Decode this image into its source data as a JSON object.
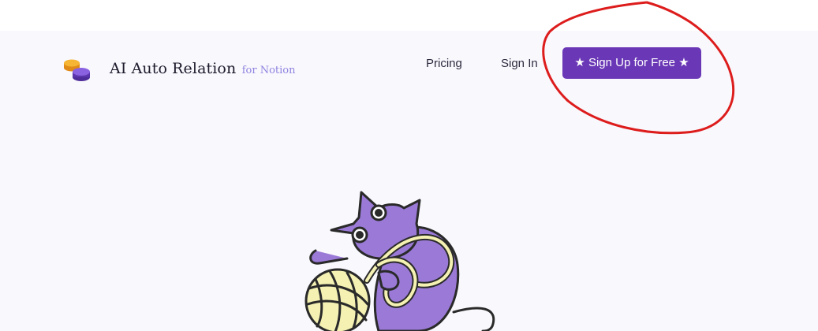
{
  "header": {
    "brand_name": "AI Auto Relation",
    "brand_suffix": "for Notion",
    "logo_icon": "stacked-coins-icon"
  },
  "nav": {
    "pricing_label": "Pricing",
    "signin_label": "Sign In",
    "signup_label": "★ Sign Up for Free ★"
  },
  "colors": {
    "accent": "#6a38b6",
    "brand_sub": "#8e83e0",
    "background": "#f9f8fd",
    "annotation": "#dd1c1c"
  },
  "hero": {
    "illustration": "cat-with-yarn-ball"
  }
}
